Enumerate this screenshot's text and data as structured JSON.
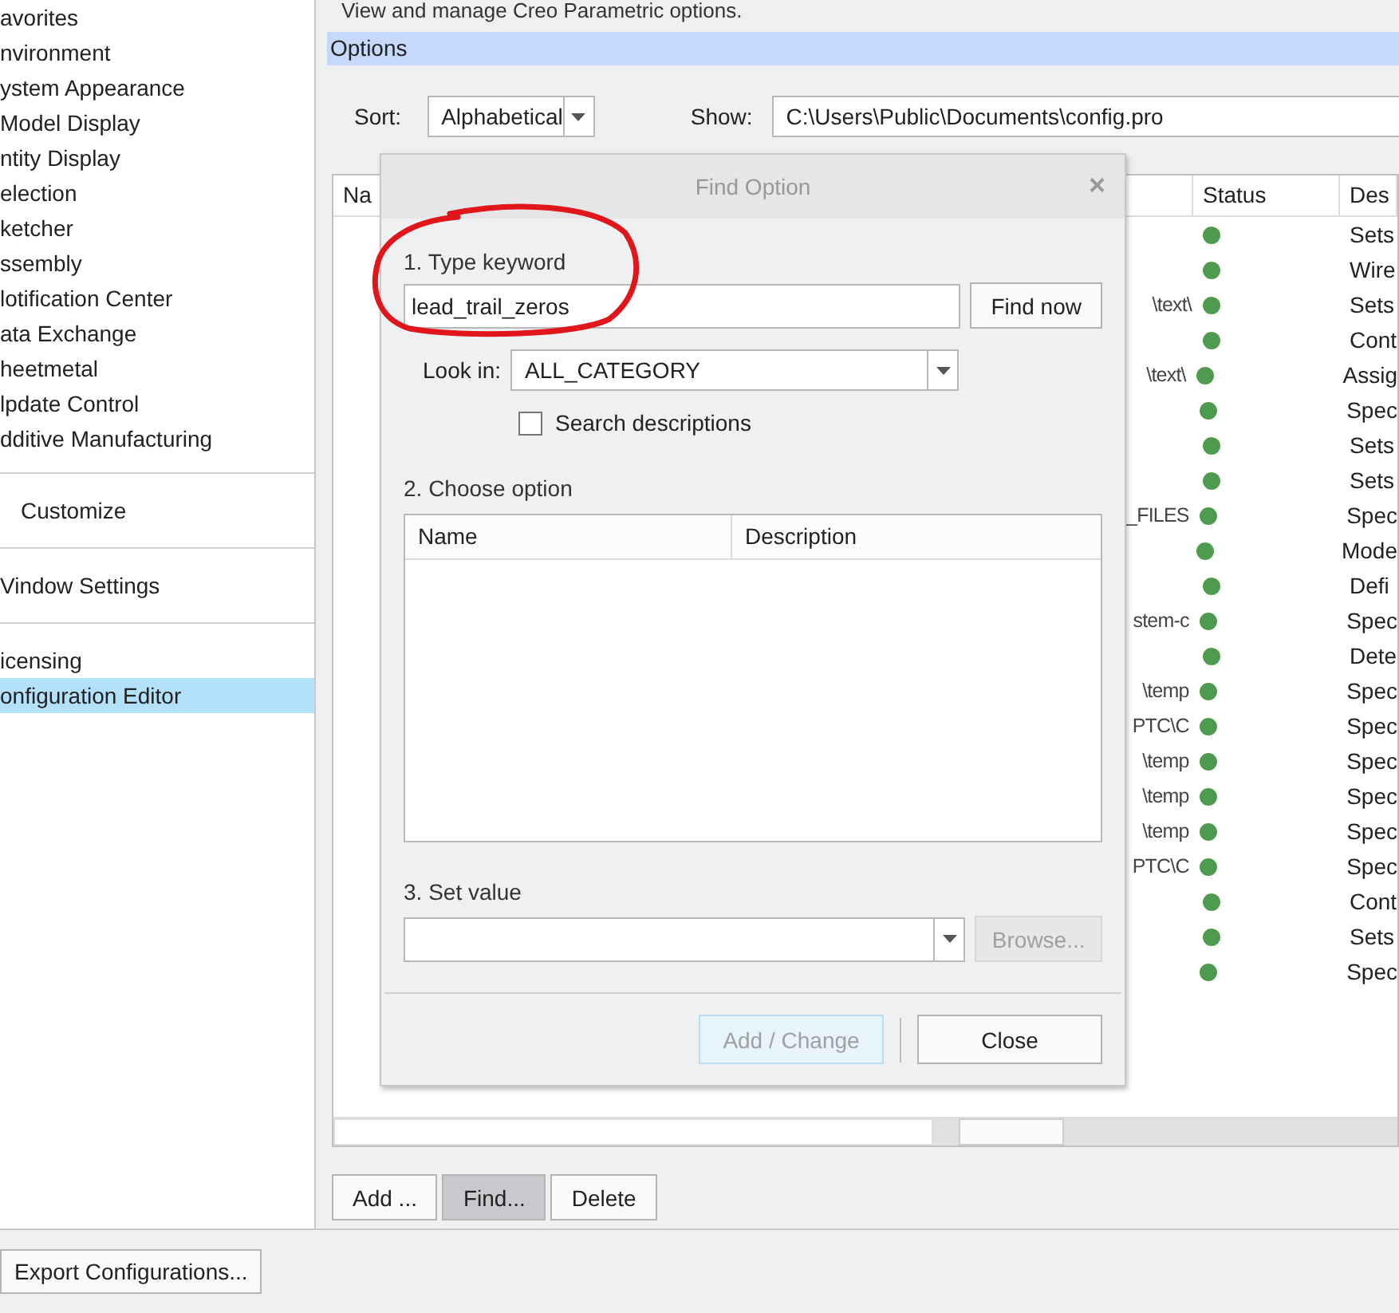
{
  "header": {
    "text": "View and manage Creo Parametric options."
  },
  "sidebar": {
    "groups": [
      {
        "items": [
          {
            "label": "avorites",
            "selected": false
          },
          {
            "label": "nvironment",
            "selected": false
          },
          {
            "label": "ystem Appearance",
            "selected": false
          },
          {
            "label": "Model Display",
            "selected": false
          },
          {
            "label": "ntity Display",
            "selected": false
          },
          {
            "label": "election",
            "selected": false
          },
          {
            "label": "ketcher",
            "selected": false
          },
          {
            "label": "ssembly",
            "selected": false
          },
          {
            "label": "lotification Center",
            "selected": false
          },
          {
            "label": "ata Exchange",
            "selected": false
          },
          {
            "label": "heetmetal",
            "selected": false
          },
          {
            "label": "lpdate Control",
            "selected": false
          },
          {
            "label": "dditive Manufacturing",
            "selected": false
          }
        ]
      },
      {
        "items": [
          {
            "label": "Customize",
            "selected": false
          }
        ]
      },
      {
        "items": [
          {
            "label": "Vindow Settings",
            "selected": false
          }
        ]
      },
      {
        "items": [
          {
            "label": "icensing",
            "selected": false
          },
          {
            "label": "onfiguration Editor",
            "selected": true
          }
        ]
      }
    ]
  },
  "options": {
    "title": "Options",
    "sort_label": "Sort:",
    "sort_value": "Alphabetical",
    "show_label": "Show:",
    "show_value": "C:\\Users\\Public\\Documents\\config.pro",
    "table": {
      "columns": [
        "Na",
        "Status",
        "Des"
      ],
      "rows": [
        {
          "value": "",
          "description": "Sets"
        },
        {
          "value": "",
          "description": "Wire"
        },
        {
          "value": "\\text\\",
          "description": "Sets"
        },
        {
          "value": "",
          "description": "Cont"
        },
        {
          "value": "\\text\\",
          "description": "Assig"
        },
        {
          "value": "",
          "description": "Spec"
        },
        {
          "value": "",
          "description": "Sets"
        },
        {
          "value": "",
          "description": "Sets"
        },
        {
          "value": "_FILES",
          "description": "Spec"
        },
        {
          "value": "",
          "description": "Mode"
        },
        {
          "value": "",
          "description": "Defi"
        },
        {
          "value": "stem-c",
          "description": "Spec"
        },
        {
          "value": "",
          "description": "Dete"
        },
        {
          "value": "\\temp",
          "description": "Spec"
        },
        {
          "value": "PTC\\C",
          "description": "Spec"
        },
        {
          "value": "\\temp",
          "description": "Spec"
        },
        {
          "value": "\\temp",
          "description": "Spec"
        },
        {
          "value": "\\temp",
          "description": "Spec"
        },
        {
          "value": "PTC\\C",
          "description": "Spec"
        },
        {
          "value": "",
          "description": "Cont"
        },
        {
          "value": "",
          "description": "Sets"
        },
        {
          "value": "",
          "description": "Spec"
        }
      ]
    },
    "buttons": [
      {
        "label": "Add ...",
        "pressed": false
      },
      {
        "label": "Find...",
        "pressed": true
      },
      {
        "label": "Delete",
        "pressed": false
      }
    ]
  },
  "footer": {
    "button": "Export Configurations..."
  },
  "dialog": {
    "title": "Find Option",
    "close": "×",
    "step1": "1.  Type keyword",
    "keyword": "lead_trail_zeros",
    "find_button": "Find now",
    "look_in_label": "Look in:",
    "look_in_value": "ALL_CATEGORY",
    "search_descriptions": {
      "label": "Search descriptions",
      "checked": false
    },
    "step2": "2.  Choose option",
    "list_columns": [
      "Name",
      "Description"
    ],
    "step3": "3.  Set value",
    "browse": {
      "label": "Browse...",
      "disabled": true
    },
    "add_change": {
      "label": "Add / Change",
      "disabled": true
    },
    "close_button": "Close"
  }
}
